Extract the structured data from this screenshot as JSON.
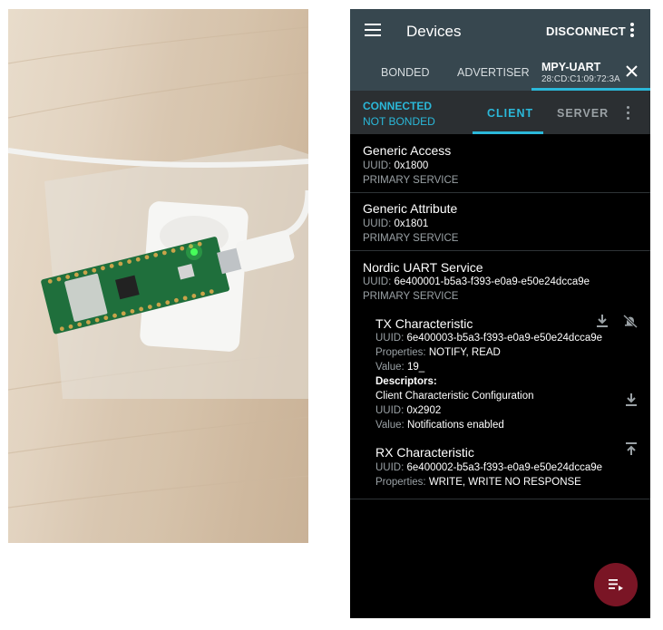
{
  "app": {
    "title": "Devices",
    "disconnect": "DISCONNECT"
  },
  "tabs": [
    {
      "label": "BONDED"
    },
    {
      "label": "ADVERTISER"
    },
    {
      "label": "MPY-UART",
      "address": "28:CD:C1:09:72:3A"
    }
  ],
  "status": {
    "connected": "CONNECTED",
    "bonded": "NOT BONDED",
    "client_tab": "CLIENT",
    "server_tab": "SERVER"
  },
  "services": [
    {
      "name": "Generic Access",
      "uuid_label": "UUID:",
      "uuid": "0x1800",
      "type": "PRIMARY SERVICE"
    },
    {
      "name": "Generic Attribute",
      "uuid_label": "UUID:",
      "uuid": "0x1801",
      "type": "PRIMARY SERVICE"
    },
    {
      "name": "Nordic UART Service",
      "uuid_label": "UUID:",
      "uuid": "6e400001-b5a3-f393-e0a9-e50e24dcca9e",
      "type": "PRIMARY SERVICE"
    }
  ],
  "tx": {
    "name": "TX Characteristic",
    "uuid_label": "UUID:",
    "uuid": "6e400003-b5a3-f393-e0a9-e50e24dcca9e",
    "props_label": "Properties:",
    "props": "NOTIFY, READ",
    "value_label": "Value:",
    "value": "19_",
    "descriptors_heading": "Descriptors:",
    "descriptor_name": "Client Characteristic Configuration",
    "descriptor_uuid_label": "UUID:",
    "descriptor_uuid": "0x2902",
    "descriptor_value_label": "Value:",
    "descriptor_value": "Notifications enabled"
  },
  "rx": {
    "name": "RX Characteristic",
    "uuid_label": "UUID:",
    "uuid": "6e400002-b5a3-f393-e0a9-e50e24dcca9e",
    "props_label": "Properties:",
    "props": "WRITE, WRITE NO RESPONSE"
  },
  "icons": {
    "menu": "hamburger-menu-icon",
    "overflow": "more-vert-icon",
    "close": "close-icon",
    "read": "download-icon",
    "notify": "notifications-off-icon",
    "write": "upload-icon",
    "fab": "log-list-icon"
  },
  "colors": {
    "toolbar": "#37474f",
    "accent": "#2bb8d9",
    "fab": "#7a1525",
    "background": "#000000"
  }
}
